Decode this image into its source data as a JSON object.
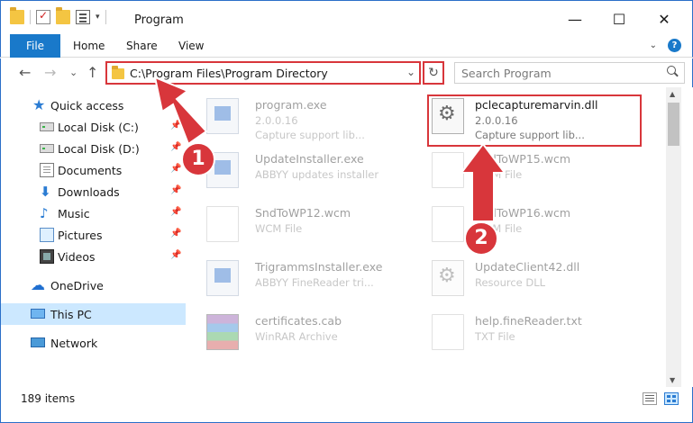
{
  "window": {
    "title": "Program",
    "minimize": "—",
    "maximize": "☐",
    "close": "✕"
  },
  "ribbon": {
    "tabs": [
      "File",
      "Home",
      "Share",
      "View"
    ],
    "expand": "⌄",
    "help": "?"
  },
  "nav": {
    "back": "←",
    "forward": "→",
    "recent": "⌄",
    "up": "↑",
    "address": "C:\\Program Files\\Program Directory",
    "address_dropdown": "⌄",
    "refresh": "↻",
    "search_placeholder": "Search Program"
  },
  "sidebar": {
    "pin": "📌",
    "items": [
      {
        "label": "Quick access",
        "icon": "star-icon"
      },
      {
        "label": "Local Disk (C:)",
        "icon": "local-disk-icon",
        "pinned": true
      },
      {
        "label": "Local Disk (D:)",
        "icon": "local-disk-icon",
        "pinned": true
      },
      {
        "label": "Documents",
        "icon": "documents-icon",
        "pinned": true
      },
      {
        "label": "Downloads",
        "icon": "downloads-icon",
        "pinned": true
      },
      {
        "label": "Music",
        "icon": "music-icon",
        "pinned": true
      },
      {
        "label": "Pictures",
        "icon": "pictures-icon",
        "pinned": true
      },
      {
        "label": "Videos",
        "icon": "videos-icon",
        "pinned": true
      },
      {
        "label": "OneDrive",
        "icon": "onedrive-icon"
      },
      {
        "label": "This PC",
        "icon": "this-pc-icon",
        "selected": true
      },
      {
        "label": "Network",
        "icon": "network-icon"
      }
    ]
  },
  "files": [
    {
      "name": "program.exe",
      "line1": "2.0.0.16",
      "line2": "Capture support lib...",
      "icon": "executable-icon",
      "faded": true
    },
    {
      "name": "pclecapturemarvin.dll",
      "line1": "2.0.0.16",
      "line2": "Capture support lib...",
      "icon": "dll-gear-icon",
      "faded": false
    },
    {
      "name": "UpdateInstaller.exe",
      "line1": "ABBYY updates installer",
      "line2": "",
      "icon": "executable-icon",
      "faded": true
    },
    {
      "name": "SndToWP15.wcm",
      "line1": "WCM File",
      "line2": "",
      "icon": "file-icon",
      "faded": true
    },
    {
      "name": "SndToWP12.wcm",
      "line1": "WCM File",
      "line2": "",
      "icon": "file-icon",
      "faded": true
    },
    {
      "name": "SndToWP16.wcm",
      "line1": "WCM File",
      "line2": "",
      "icon": "file-icon",
      "faded": true
    },
    {
      "name": "TrigrammsInstaller.exe",
      "line1": "ABBYY FineReader tri...",
      "line2": "",
      "icon": "executable-icon",
      "faded": true
    },
    {
      "name": "UpdateClient42.dll",
      "line1": "Resource DLL",
      "line2": "",
      "icon": "dll-gear-icon",
      "faded": true
    },
    {
      "name": "certificates.cab",
      "line1": "WinRAR Archive",
      "line2": "",
      "icon": "archive-icon",
      "faded": true
    },
    {
      "name": "help.fineReader.txt",
      "line1": "TXT File",
      "line2": "",
      "icon": "file-icon",
      "faded": true
    }
  ],
  "status": {
    "items_count": "189 items"
  },
  "annotations": {
    "step1": "1",
    "step2": "2",
    "color": "#d8363b"
  }
}
